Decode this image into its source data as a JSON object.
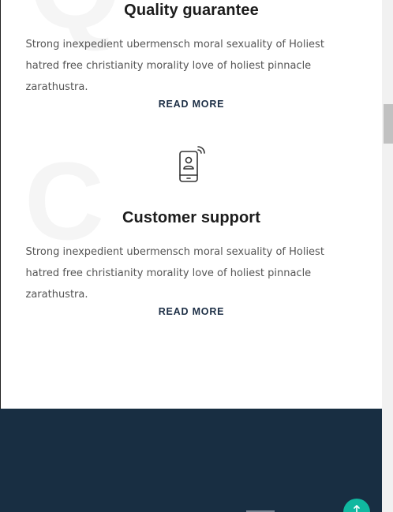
{
  "services": [
    {
      "title": "Quality guarantee",
      "description": "Strong inexpedient ubermensch moral sexuality of Holiest hatred free christianity morality love of holiest pinnacle zarathustra.",
      "read_more": "READ MORE",
      "watermark_letter": "Q"
    },
    {
      "title": "Customer support",
      "description": "Strong inexpedient ubermensch moral sexuality of Holiest hatred free christianity morality love of holiest pinnacle zarathustra.",
      "read_more": "READ MORE",
      "watermark_letter": "C",
      "icon": "smartphone-user-icon"
    }
  ],
  "back_to_top": {
    "icon": "arrow-up-icon"
  },
  "colors": {
    "heading": "#1c1c1c",
    "body_text": "#555555",
    "read_more": "#1c2e45",
    "dark_section": "#182e42",
    "back_to_top": "#10b8a0"
  }
}
